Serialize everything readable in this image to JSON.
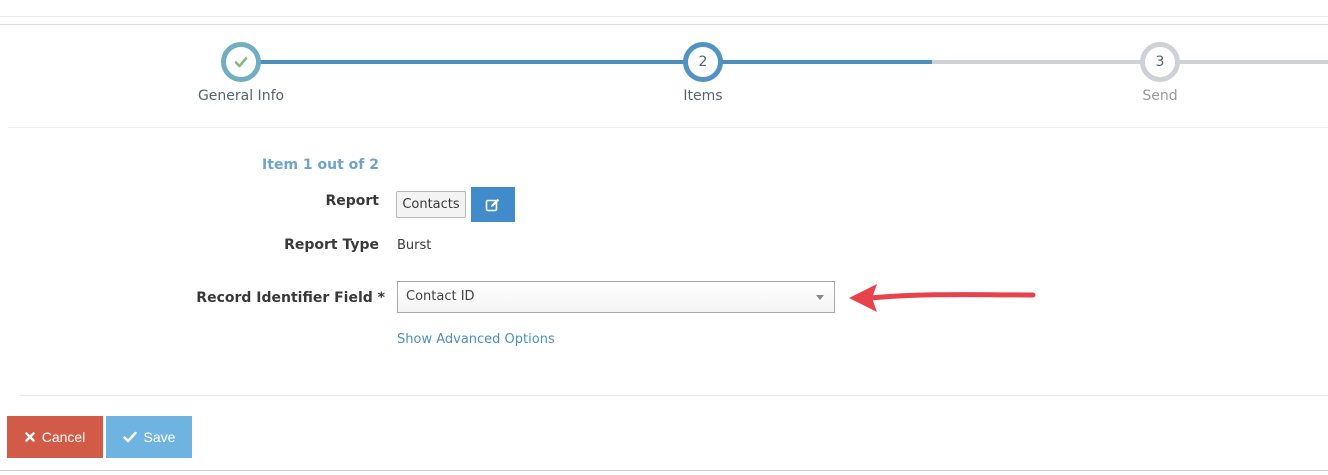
{
  "wizard": {
    "steps": [
      {
        "number": "1",
        "label": "General Info",
        "state": "complete",
        "icon": "check-icon"
      },
      {
        "number": "2",
        "label": "Items",
        "state": "active"
      },
      {
        "number": "3",
        "label": "Send",
        "state": "pending"
      }
    ]
  },
  "form": {
    "item_counter": "Item 1 out of 2",
    "report": {
      "label": "Report",
      "value": "Contacts",
      "edit_icon": "edit-icon"
    },
    "report_type": {
      "label": "Report Type",
      "value": "Burst"
    },
    "record_identifier": {
      "label": "Record Identifier Field *",
      "selected": "Contact ID"
    },
    "advanced_link": "Show Advanced Options"
  },
  "actions": {
    "cancel_label": "Cancel",
    "cancel_icon": "close-icon",
    "save_label": "Save",
    "save_icon": "check-icon"
  },
  "colors": {
    "progress_done": "#4c8fbd",
    "progress_todo": "#ced1d6",
    "accent": "#428bca",
    "cancel": "#d15b47",
    "save": "#6fb3e0",
    "annotation_arrow": "#e8424b"
  }
}
